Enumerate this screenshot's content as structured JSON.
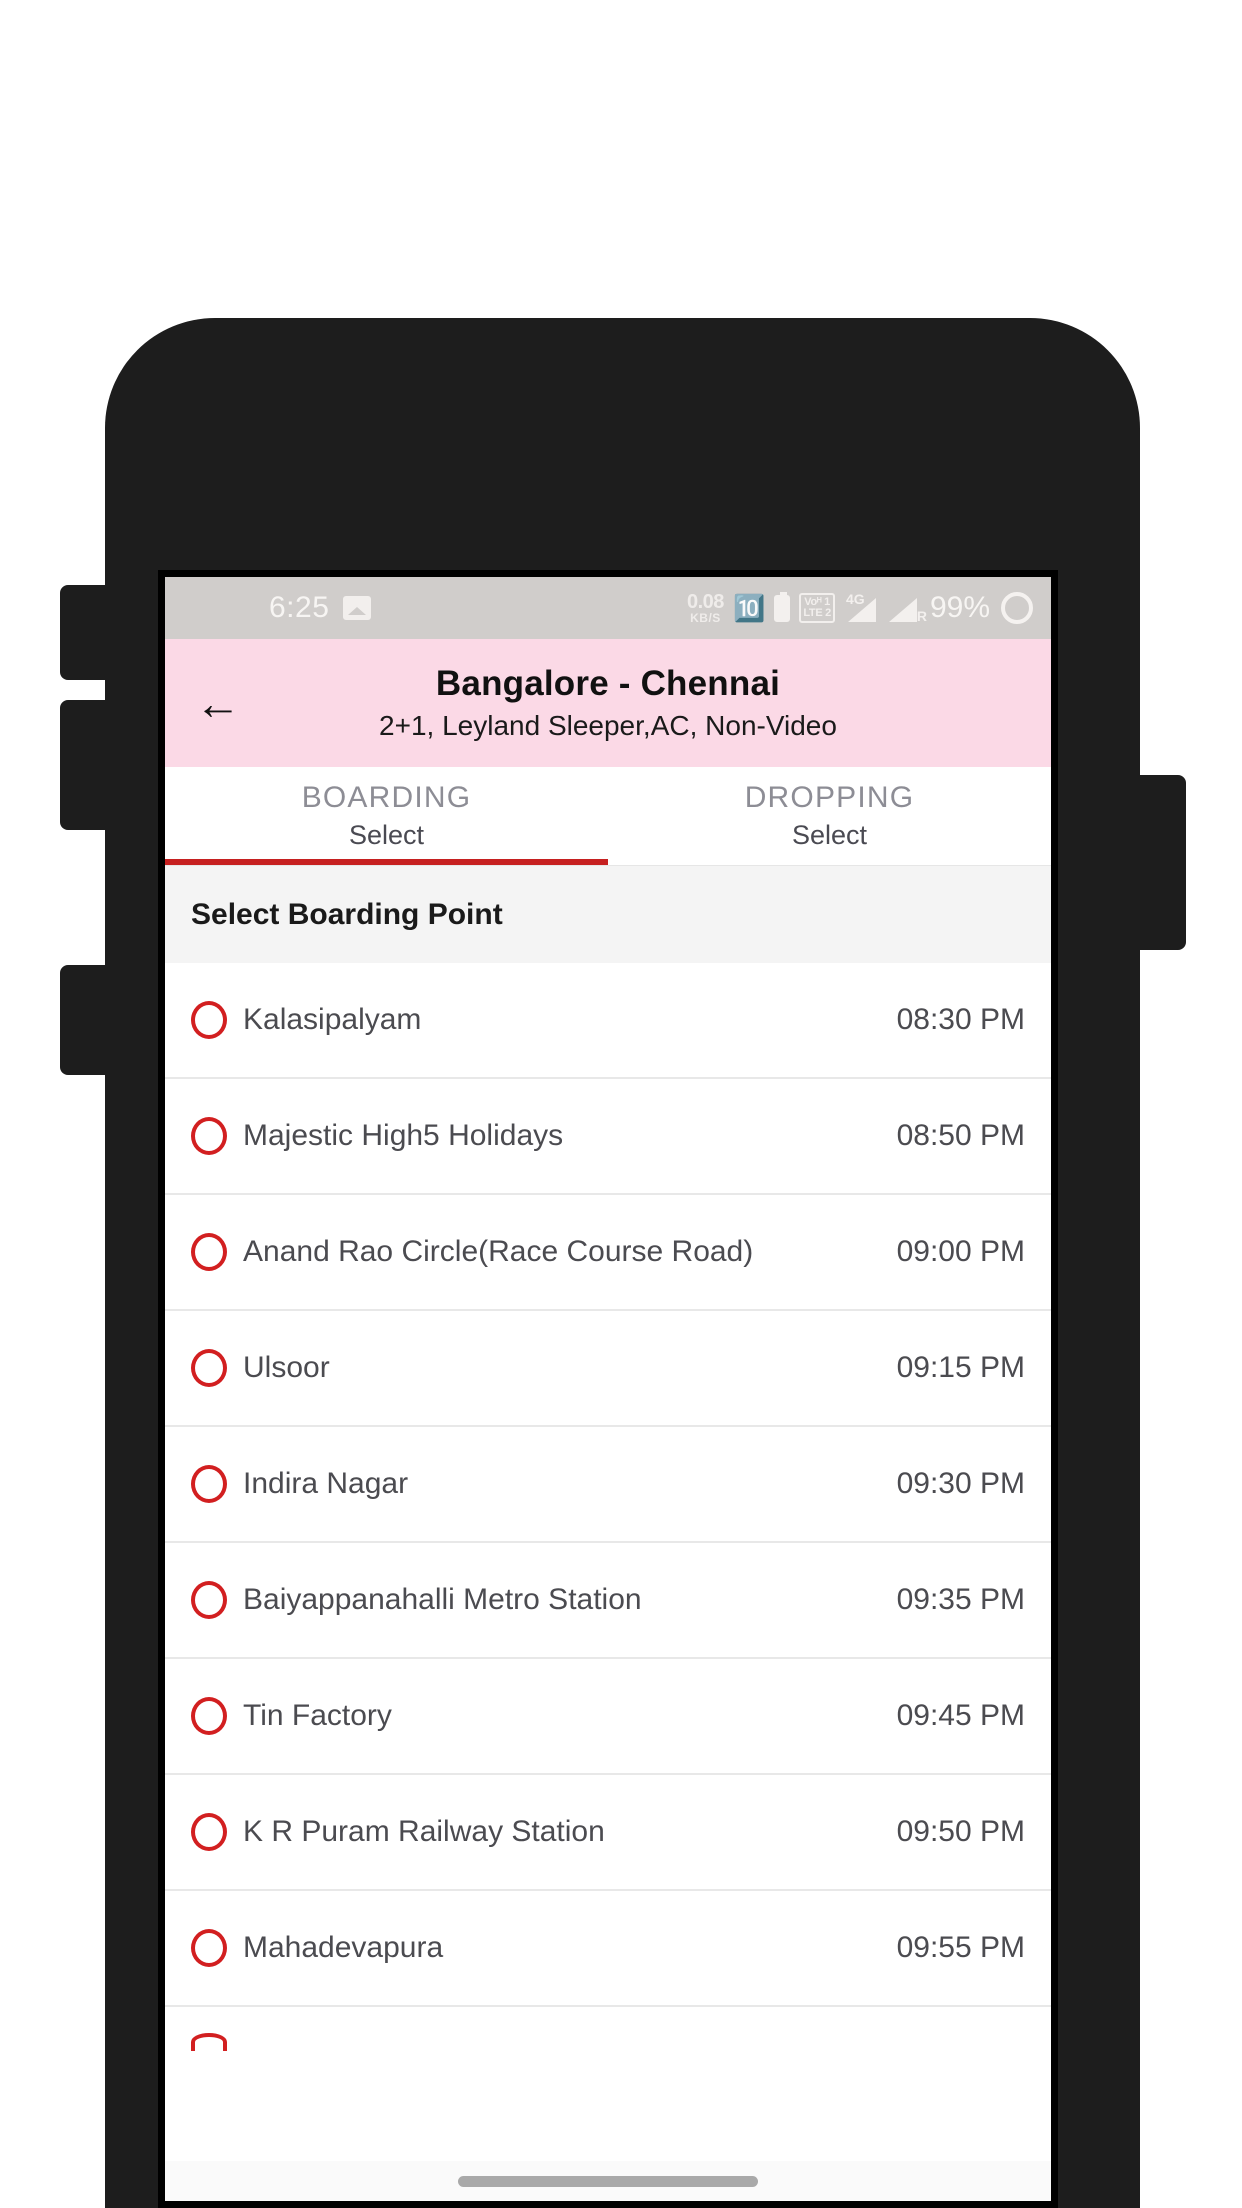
{
  "status_bar": {
    "time": "6:25",
    "photo_icon": "photo-icon",
    "data_rate_value": "0.08",
    "data_rate_unit": "KB/S",
    "bluetooth_icon": "bluetooth-icon",
    "usb_battery_icon": "usb-battery-icon",
    "volte_line1": "Voᴴ 1",
    "volte_line2": "LTE 2",
    "signal1_label": "4G",
    "signal2_label": "R",
    "battery_percent": "99%",
    "battery_icon": "battery-circle-icon"
  },
  "appbar": {
    "back_icon": "back-arrow-icon",
    "title": "Bangalore - Chennai",
    "subtitle": "2+1, Leyland Sleeper,AC, Non-Video",
    "background_color": "#fbd9e6"
  },
  "tabs": [
    {
      "title": "BOARDING",
      "subtitle": "Select",
      "active": true
    },
    {
      "title": "DROPPING",
      "subtitle": "Select",
      "active": false
    }
  ],
  "accent_color": "#c62020",
  "section": {
    "heading": "Select Boarding Point"
  },
  "boarding_points": [
    {
      "name": "Kalasipalyam",
      "time": "08:30 PM"
    },
    {
      "name": "Majestic High5 Holidays",
      "time": "08:50 PM"
    },
    {
      "name": "Anand Rao Circle(Race Course Road)",
      "time": "09:00 PM"
    },
    {
      "name": "Ulsoor",
      "time": "09:15 PM"
    },
    {
      "name": "Indira Nagar",
      "time": "09:30 PM"
    },
    {
      "name": "Baiyappanahalli Metro Station",
      "time": "09:35 PM"
    },
    {
      "name": "Tin Factory",
      "time": "09:45 PM"
    },
    {
      "name": "K R Puram Railway Station",
      "time": "09:50 PM"
    },
    {
      "name": "Mahadevapura",
      "time": "09:55 PM"
    }
  ]
}
